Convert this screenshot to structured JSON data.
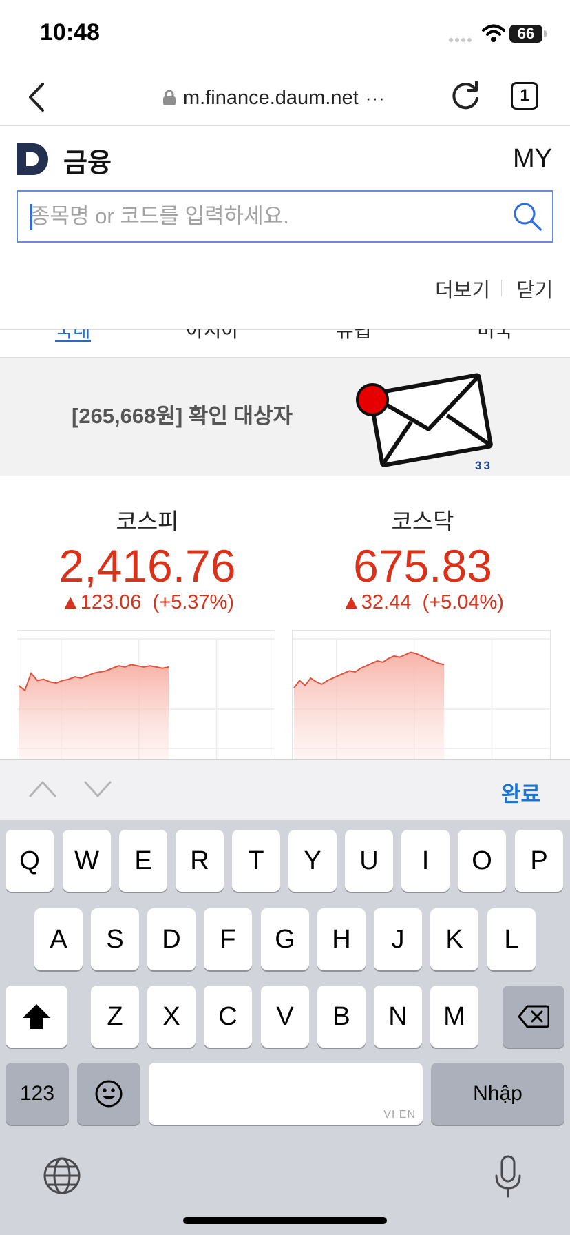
{
  "status_bar": {
    "time": "10:48",
    "battery": "66"
  },
  "browser": {
    "url": "m.finance.daum.net",
    "more_indicator": "···",
    "tab_count": "1"
  },
  "header": {
    "title": "금융",
    "my": "MY"
  },
  "search": {
    "placeholder": "종목명 or 코드를 입력하세요.",
    "value": ""
  },
  "links": {
    "more": "더보기",
    "close": "닫기"
  },
  "region_tabs": [
    "국내",
    "아시아",
    "유럽",
    "미국"
  ],
  "ad": {
    "text": "[265,668원] 확인 대상자",
    "badge_number": "33"
  },
  "indices": [
    {
      "name": "코스피",
      "value": "2,416.76",
      "change_symbol": "▲",
      "change": "123.06",
      "change_pct": "(+5.37%)",
      "chart_data": {
        "type": "area",
        "values": [
          0.62,
          0.58,
          0.72,
          0.66,
          0.67,
          0.65,
          0.64,
          0.66,
          0.67,
          0.69,
          0.68,
          0.7,
          0.72,
          0.73,
          0.74,
          0.76,
          0.78,
          0.77,
          0.79,
          0.78,
          0.77,
          0.78,
          0.77,
          0.76,
          0.77
        ]
      }
    },
    {
      "name": "코스닥",
      "value": "675.83",
      "change_symbol": "▲",
      "change": "32.44",
      "change_pct": "(+5.04%)",
      "chart_data": {
        "type": "area",
        "values": [
          0.6,
          0.66,
          0.62,
          0.68,
          0.65,
          0.63,
          0.66,
          0.68,
          0.7,
          0.72,
          0.74,
          0.73,
          0.76,
          0.78,
          0.8,
          0.82,
          0.81,
          0.84,
          0.86,
          0.85,
          0.87,
          0.89,
          0.88,
          0.86,
          0.84,
          0.82,
          0.8,
          0.79
        ]
      }
    }
  ],
  "accessory": {
    "done": "완료"
  },
  "keyboard": {
    "row1": [
      "Q",
      "W",
      "E",
      "R",
      "T",
      "Y",
      "U",
      "I",
      "O",
      "P"
    ],
    "row2": [
      "A",
      "S",
      "D",
      "F",
      "G",
      "H",
      "J",
      "K",
      "L"
    ],
    "row3": [
      "Z",
      "X",
      "C",
      "V",
      "B",
      "N",
      "M"
    ],
    "numbers_label": "123",
    "return_label": "Nhập",
    "space_hint": "VI EN"
  }
}
